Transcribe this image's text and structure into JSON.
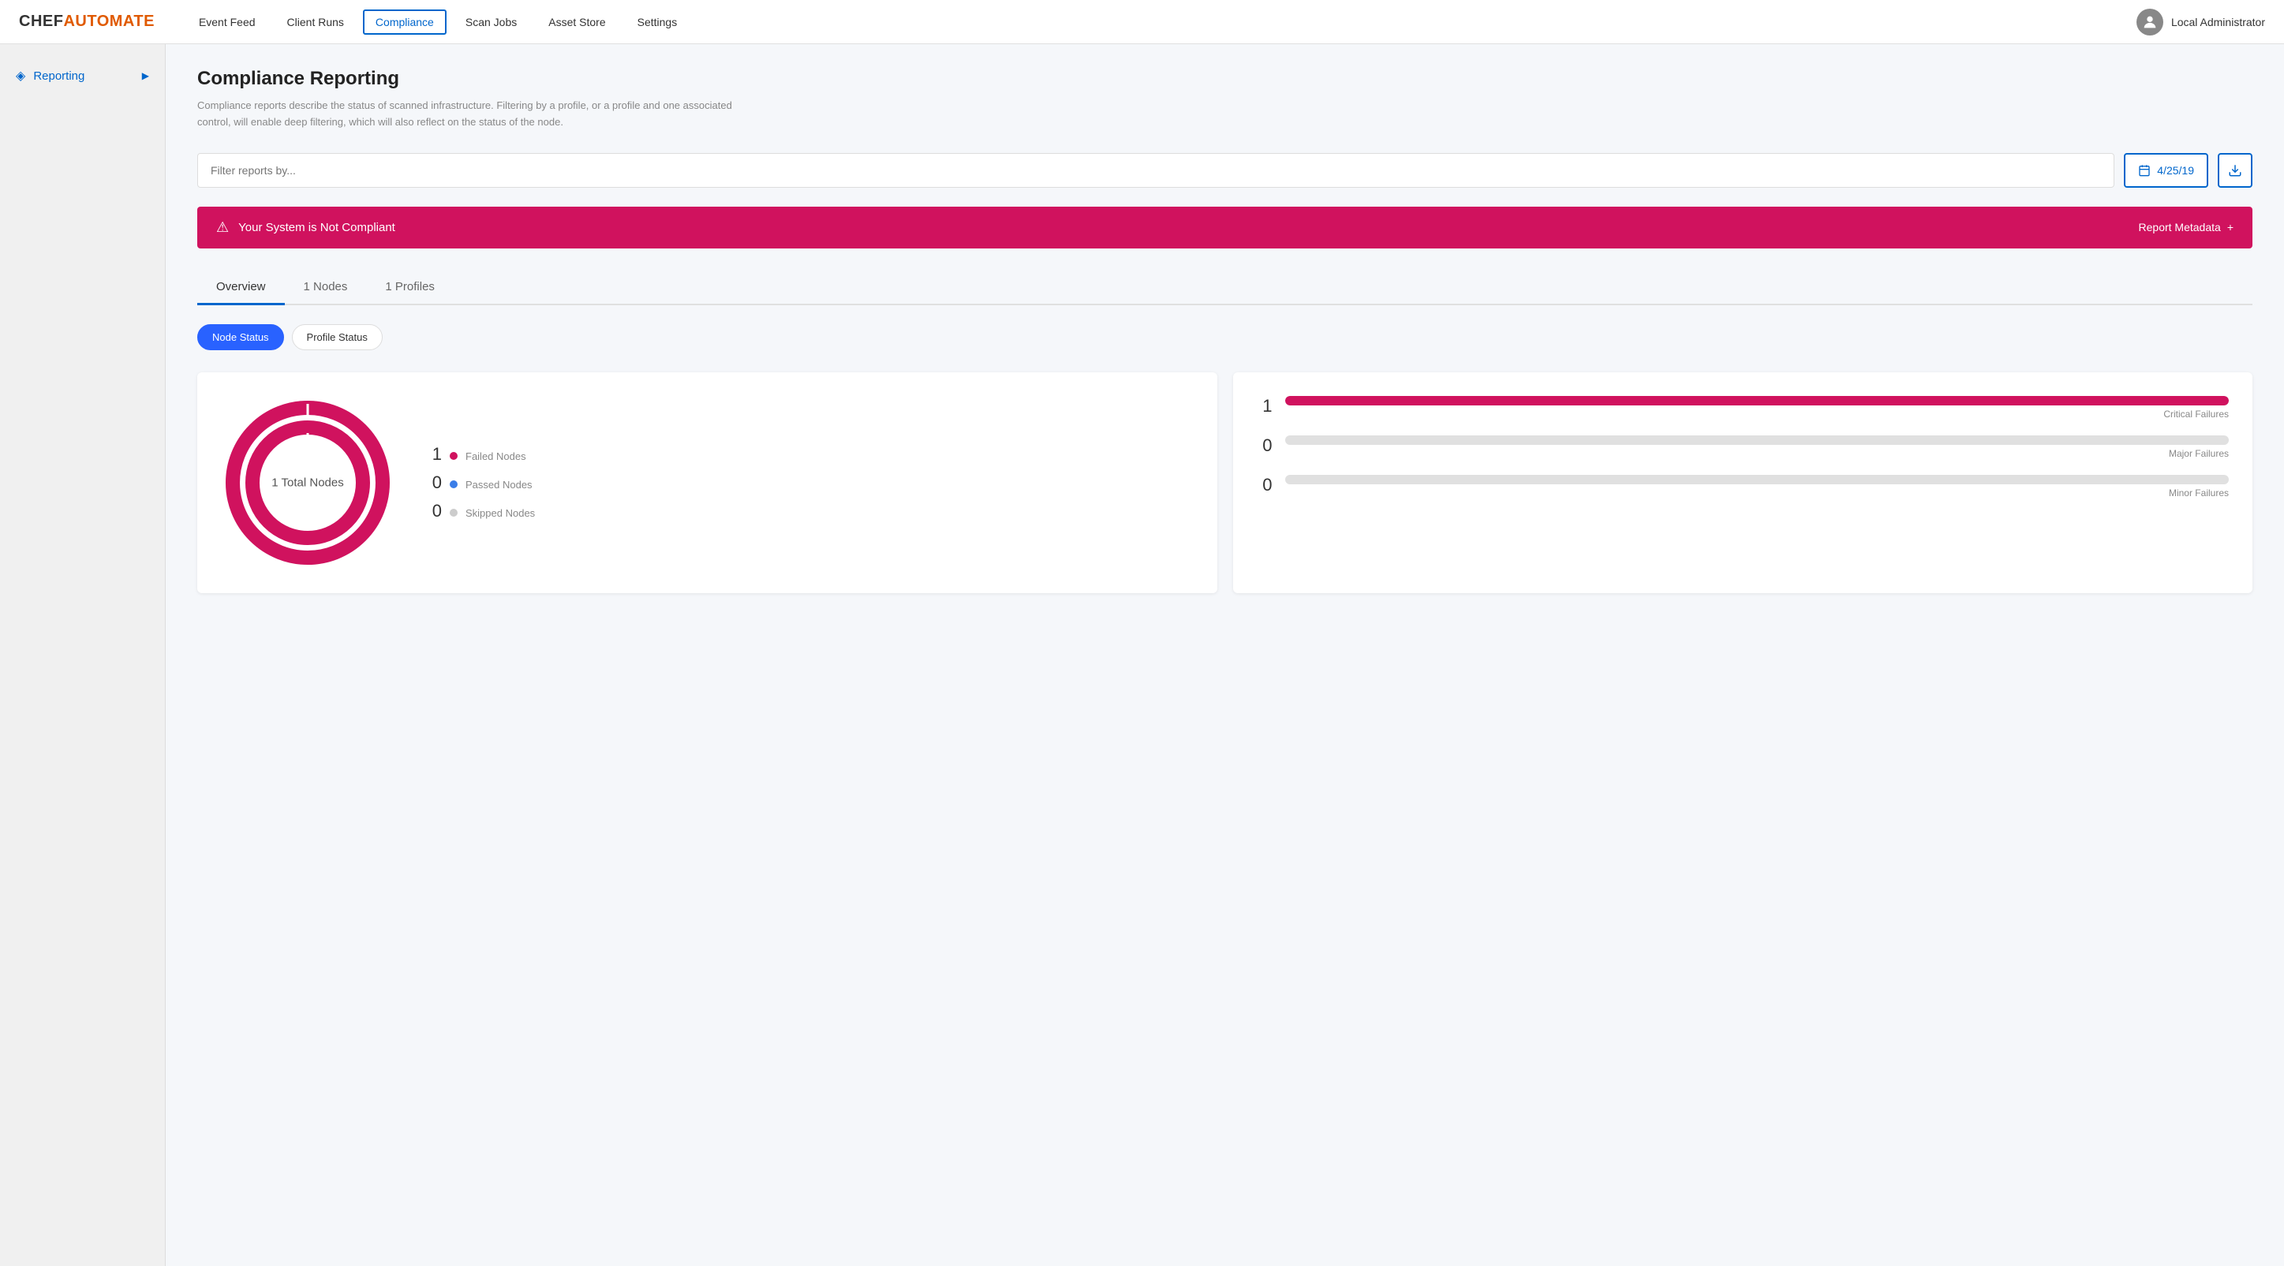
{
  "logo": {
    "chef": "CHEF",
    "automate": "AUTOMATE"
  },
  "nav": {
    "links": [
      {
        "label": "Event Feed",
        "active": false
      },
      {
        "label": "Client Runs",
        "active": false
      },
      {
        "label": "Compliance",
        "active": true
      },
      {
        "label": "Scan Jobs",
        "active": false
      },
      {
        "label": "Asset Store",
        "active": false
      },
      {
        "label": "Settings",
        "active": false
      }
    ],
    "user_name": "Local Administrator"
  },
  "sidebar": {
    "items": [
      {
        "label": "Reporting",
        "icon": "◈",
        "active": true
      }
    ]
  },
  "page": {
    "title": "Compliance Reporting",
    "description": "Compliance reports describe the status of scanned infrastructure. Filtering by a profile, or a profile and one associated control, will enable deep filtering, which will also reflect on the status of the node.",
    "filter_placeholder": "Filter reports by...",
    "date_label": "4/25/19",
    "banner_text": "Your System is Not Compliant",
    "report_metadata_label": "Report Metadata",
    "tabs": [
      {
        "label": "Overview",
        "active": true
      },
      {
        "label": "1 Nodes",
        "active": false
      },
      {
        "label": "1 Profiles",
        "active": false
      }
    ],
    "status_buttons": [
      {
        "label": "Node Status",
        "active": true
      },
      {
        "label": "Profile Status",
        "active": false
      }
    ],
    "donut_chart": {
      "center_label": "1 Total Nodes",
      "total": 1,
      "legend": [
        {
          "label": "Failed Nodes",
          "count": "1",
          "color": "#d0125e"
        },
        {
          "label": "Passed Nodes",
          "count": "0",
          "color": "#3a7de8"
        },
        {
          "label": "Skipped Nodes",
          "count": "0",
          "color": "#ccc"
        }
      ]
    },
    "bar_chart": {
      "items": [
        {
          "label": "Critical Failures",
          "count": "1",
          "fill_pct": 100,
          "color": "#d0125e"
        },
        {
          "label": "Major Failures",
          "count": "0",
          "fill_pct": 0,
          "color": "#d0125e"
        },
        {
          "label": "Minor Failures",
          "count": "0",
          "fill_pct": 0,
          "color": "#d0125e"
        }
      ]
    }
  }
}
